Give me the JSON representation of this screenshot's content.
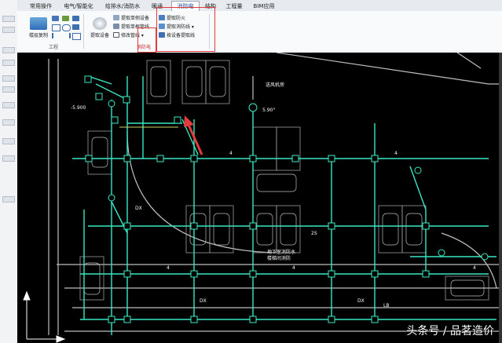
{
  "ribbon": {
    "tabs": [
      {
        "label": "常用操作"
      },
      {
        "label": "电气/智能化"
      },
      {
        "label": "给排水/消防水"
      },
      {
        "label": "暖通"
      },
      {
        "label": "消防电"
      },
      {
        "label": "结构"
      },
      {
        "label": "工程量"
      },
      {
        "label": "BIM应用"
      }
    ],
    "active_tab": "消防电",
    "groups": {
      "project": {
        "title": "工程",
        "floor_btn": "楼层复制",
        "icons": [
          "save-icon",
          "undo-icon",
          "redo-icon",
          "copy-icon",
          "refresh-icon",
          "grid-icon"
        ]
      },
      "fire": {
        "title": "消防电",
        "device_btn": "提取设备",
        "buttons": [
          "提取单侧设备",
          "提取单根管线",
          "修改管线"
        ],
        "right_buttons": [
          "提取防火",
          "提取消防线",
          "按设备提取线"
        ]
      }
    }
  },
  "drawing": {
    "elevation": "-5.900",
    "room_label": "送风机房",
    "room_label_2": "地下室消防水",
    "room_label_3": "楼梯间消防",
    "angle_label": "5.90°",
    "labels_4": "4",
    "labels_dx": "DX",
    "labels_2s": "2S",
    "labels_lb": "LB"
  },
  "watermark": "头条号 / 品茗造价",
  "colors": {
    "ribbon_bg": "#f9fafb",
    "canvas_bg": "#000000",
    "pipe": "#38e8c4",
    "wall": "#c8c8c8",
    "highlight": "#e23b3b"
  }
}
